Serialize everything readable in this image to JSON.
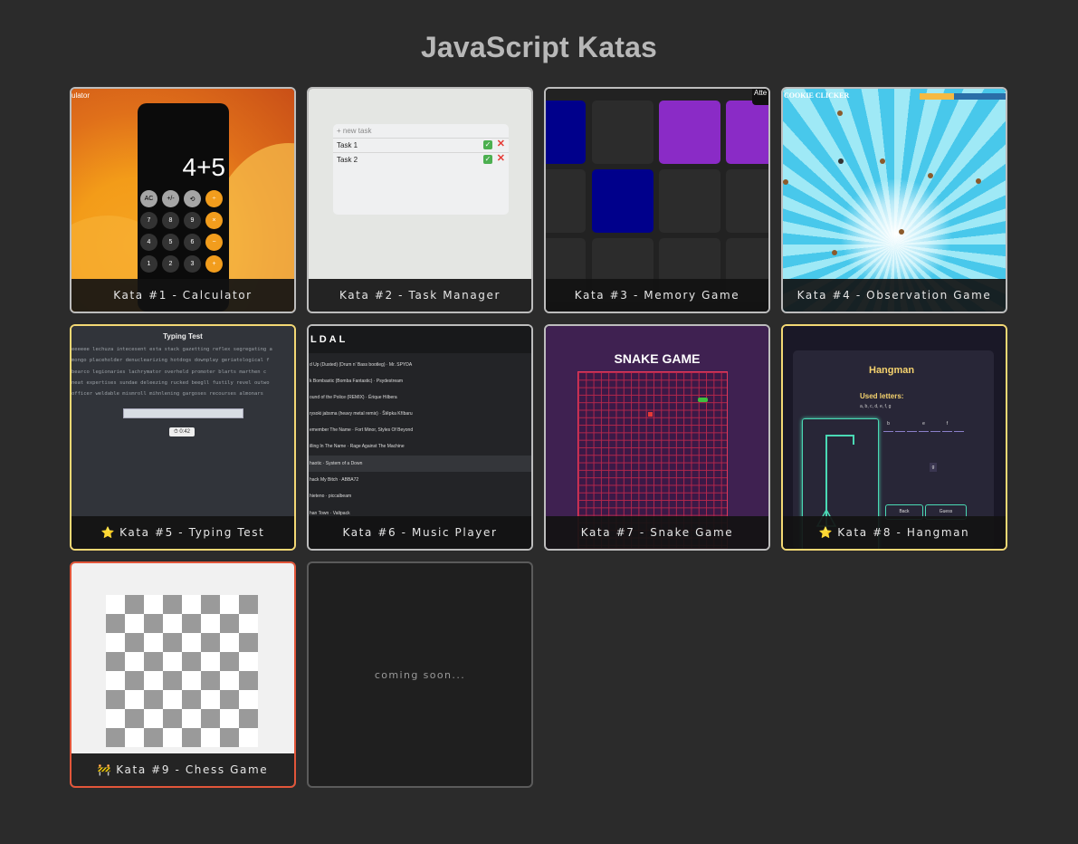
{
  "page": {
    "title": "JavaScript Katas"
  },
  "cards": [
    {
      "label": "Kata #1 - Calculator",
      "star": ""
    },
    {
      "label": "Kata #2 - Task Manager",
      "star": ""
    },
    {
      "label": "Kata #3 - Memory Game",
      "star": ""
    },
    {
      "label": "Kata #4 - Observation Game",
      "star": ""
    },
    {
      "label": "Kata #5 - Typing Test",
      "star": "⭐"
    },
    {
      "label": "Kata #6 - Music Player",
      "star": ""
    },
    {
      "label": "Kata #7 - Snake Game",
      "star": ""
    },
    {
      "label": "Kata #8 - Hangman",
      "star": "⭐"
    },
    {
      "label": "Kata #9 - Chess Game",
      "star": "🚧"
    }
  ],
  "coming_soon": "coming soon...",
  "thumbs": {
    "calculator": {
      "title": "ulator",
      "display": "4+5",
      "keys": [
        [
          "AC",
          "+/-",
          "⟲",
          "÷"
        ],
        [
          "7",
          "8",
          "9",
          "×"
        ],
        [
          "4",
          "5",
          "6",
          "−"
        ],
        [
          "1",
          "2",
          "3",
          "+"
        ]
      ]
    },
    "task": {
      "placeholder": "+ new task",
      "tasks": [
        "Task 1",
        "Task 2"
      ]
    },
    "memory": {
      "attempts": "Atte"
    },
    "observation": {
      "title": "COOKIE CLICKER"
    },
    "typing": {
      "heading": "Typing Test",
      "timer": "⏱ 0:42",
      "lines": [
        "eeeeee lechuza intecesent esta stack gazetting reflex segregating a",
        "mongo placeholder denuclearizing hotdogs downplay geriatological f",
        "bearco legionaries lachrymator overheld promoter blarts marthen c",
        "neat expertises sundae deleezing rucked beegll fustily revel outwo",
        "officer weldable mismroll mihnlening gargoses recourses almonars"
      ]
    },
    "music": {
      "logo": "LDAL",
      "songs": [
        "d Up (Dusted) (Drum n' Bass bootleg) · Mr. SPYDA",
        "k Bombastic (Bomba Fantastic) · Psydestream",
        "ound of the Police (REMIX) · Ërique Hilbera",
        "rysoki jabsma (heavy metal remix) · Štěpka Kříbaru",
        "emember The Name · Fort Minor, Styles Of Beyond",
        "illing In The Name · Rage Against The Machine",
        "haotic · System of a Down",
        "hack My Bitch · ABBA72",
        "hieteno · piccalbeam",
        "han Town · Valtpack"
      ]
    },
    "snake": {
      "title": "SNAKE GAME"
    },
    "hangman": {
      "title": "Hangman",
      "used_label": "Used letters:",
      "used": "a, b, c, d, e, f, g",
      "slots": [
        "b",
        "",
        "",
        "e",
        "",
        "f",
        ""
      ],
      "guess_letter": "g",
      "back": "Back",
      "guess": "Guess"
    }
  }
}
